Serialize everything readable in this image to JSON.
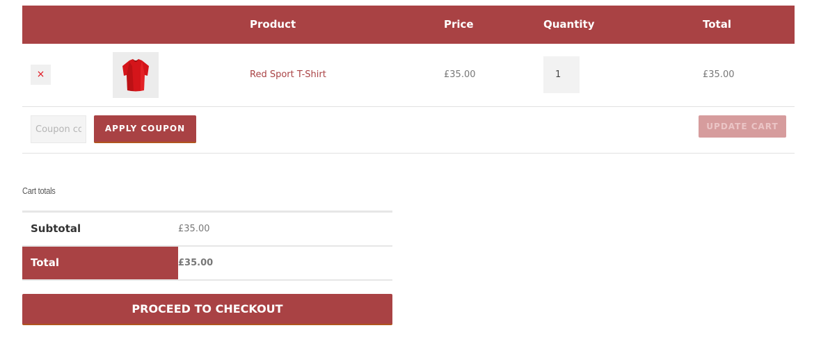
{
  "cart": {
    "headers": {
      "product": "Product",
      "price": "Price",
      "quantity": "Quantity",
      "total": "Total"
    },
    "items": [
      {
        "remove_icon": "×",
        "thumbnail_icon": "red-tshirt-image",
        "name": "Red Sport T-Shirt",
        "price": "£35.00",
        "quantity": "1",
        "subtotal": "£35.00"
      }
    ],
    "coupon": {
      "placeholder": "Coupon code",
      "value": "",
      "apply_label": "APPLY COUPON"
    },
    "update_label": "UPDATE CART"
  },
  "totals": {
    "title": "Cart totals",
    "subtotal_label": "Subtotal",
    "subtotal_value": "£35.00",
    "total_label": "Total",
    "total_value": "£35.00",
    "checkout_label": "PROCEED TO CHECKOUT"
  },
  "colors": {
    "accent": "#a94244",
    "remove_icon": "#e0121c",
    "disabled_button": "#d69c9d"
  }
}
